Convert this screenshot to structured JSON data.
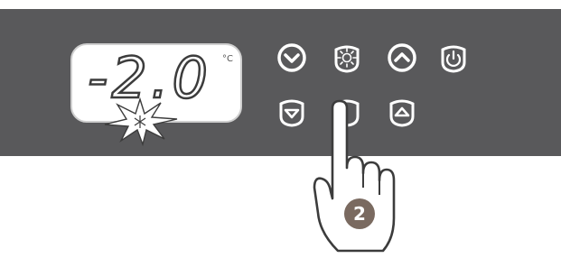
{
  "display": {
    "temperature": "-2.0",
    "unit": "°C",
    "status_icon": "snowflake-icon"
  },
  "buttons": {
    "row1": [
      "chevron-down-icon",
      "sun-icon",
      "chevron-up-icon",
      "power-icon"
    ],
    "row2": [
      "chevron-down-icon",
      "pressed-button",
      "chevron-up-icon"
    ]
  },
  "step_badge": "2",
  "colors": {
    "panel": "#59595b",
    "display_bg": "#ffffff",
    "icon": "#ffffff",
    "badge": "#7a6a60"
  }
}
